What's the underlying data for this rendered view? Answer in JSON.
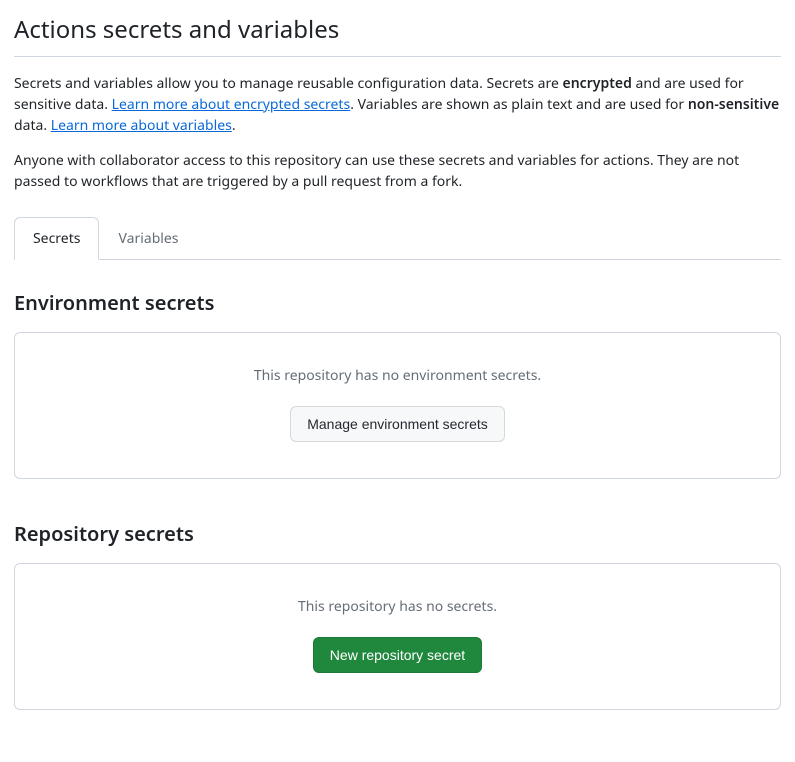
{
  "header": {
    "title": "Actions secrets and variables"
  },
  "description": {
    "intro": "Secrets and variables allow you to manage reusable configuration data. Secrets are ",
    "encrypted": "encrypted",
    "afterEncrypted": " and are used for sensitive data. ",
    "learnSecretsLink": "Learn more about encrypted secrets",
    "afterLearnSecrets": ". Variables are shown as plain text and are used for ",
    "nonSensitive": "non-sensitive",
    "afterNonSensitive": " data. ",
    "learnVariablesLink": "Learn more about variables",
    "period": "."
  },
  "subdescription": "Anyone with collaborator access to this repository can use these secrets and variables for actions. They are not passed to workflows that are triggered by a pull request from a fork.",
  "tabs": {
    "secrets": "Secrets",
    "variables": "Variables"
  },
  "sections": {
    "env": {
      "title": "Environment secrets",
      "emptyMsg": "This repository has no environment secrets.",
      "buttonLabel": "Manage environment secrets"
    },
    "repo": {
      "title": "Repository secrets",
      "emptyMsg": "This repository has no secrets.",
      "buttonLabel": "New repository secret"
    }
  }
}
